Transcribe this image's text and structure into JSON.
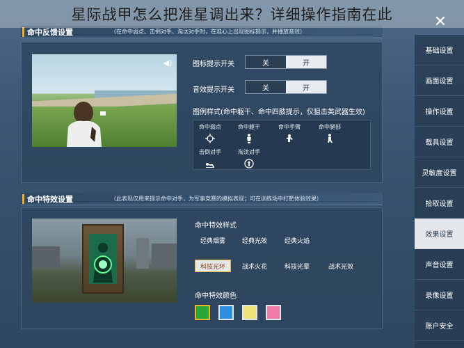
{
  "article_title": "星际战甲怎么把准星调出来？详细操作指南在此",
  "close_label": "✕",
  "hit_feedback": {
    "title": "命中反馈设置",
    "note": "（在命中弱点、击倒对手、淘汰对手时，在准心上出现图标提示，并播放音效）",
    "icon_toggle_label": "图标提示开关",
    "sound_toggle_label": "音效提示开关",
    "off_label": "关",
    "on_label": "开",
    "style_label": "图例样式(命中躯干、命中四肢提示，仅狙击类武器生效)",
    "styles": [
      {
        "label": "命中弱点",
        "icon": "crosshair-icon"
      },
      {
        "label": "命中躯干",
        "icon": "torso-icon"
      },
      {
        "label": "命中手臂",
        "icon": "arm-icon"
      },
      {
        "label": "命中腿部",
        "icon": "leg-icon"
      },
      {
        "label": "击倒对手",
        "icon": "knockdown-icon"
      },
      {
        "label": "淘汰对手",
        "icon": "eliminate-icon"
      }
    ]
  },
  "hit_effect": {
    "title": "命中特效设置",
    "note": "（此表现仅用来提示命中对手，为军事竞赛的模拟表现；可在训练场中打靶体验效果）",
    "style_heading": "命中特效样式",
    "styles_row1": [
      "经典烟雾",
      "经典光效",
      "经典火焰"
    ],
    "styles_row2": [
      "科技光环",
      "战术火花",
      "科技光晕",
      "战术光效"
    ],
    "selected_style": "科技光环",
    "color_heading": "命中特效颜色",
    "colors": [
      "#2aa63a",
      "#2d8fe0",
      "#f2e27a",
      "#f07aa8"
    ],
    "selected_color": "#2aa63a"
  },
  "right_menu": {
    "items": [
      "基础设置",
      "画面设置",
      "操作设置",
      "载具设置",
      "灵敏度设置",
      "拾取设置",
      "效果设置",
      "声音设置",
      "录像设置",
      "账户安全"
    ],
    "active": "效果设置"
  },
  "colors": {
    "accent": "#f0b323",
    "toggle_on": "#e8ecf0",
    "toggle_off": "#2a3e54"
  }
}
